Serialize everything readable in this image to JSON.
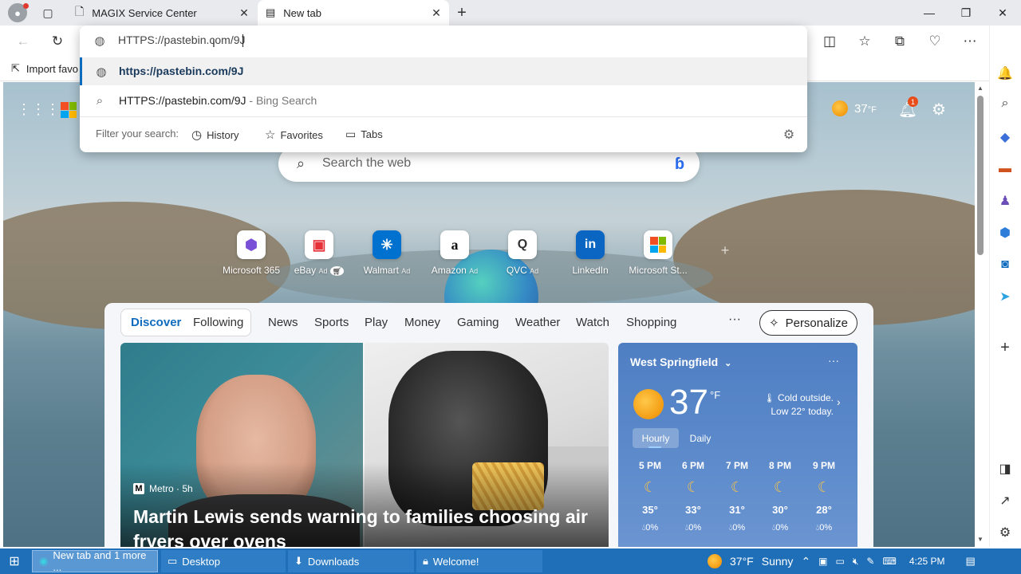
{
  "browser": {
    "tabs": [
      {
        "title": "MAGIX Service Center"
      },
      {
        "title": "New tab"
      }
    ],
    "favorites_bar": {
      "import_label": "Import favo"
    }
  },
  "omnibox": {
    "input_value": "HTTPS://pastebin.com/9J",
    "suggestion_url": "https://pastebin.com/9J",
    "suggestion_search": "HTTPS://pastebin.com/9J",
    "suggestion_search_suffix": " - Bing Search",
    "filter_label": "Filter your search:",
    "filters": [
      "History",
      "Favorites",
      "Tabs"
    ]
  },
  "ntp": {
    "weather_temp": "37",
    "weather_unit": "°F",
    "notification_count": "1",
    "search_placeholder": "Search the web",
    "quick_links": [
      {
        "label": "Microsoft 365",
        "ad": ""
      },
      {
        "label": "eBay",
        "ad": "Ad"
      },
      {
        "label": "Walmart",
        "ad": "Ad"
      },
      {
        "label": "Amazon",
        "ad": "Ad"
      },
      {
        "label": "QVC",
        "ad": "Ad"
      },
      {
        "label": "LinkedIn",
        "ad": ""
      },
      {
        "label": "Microsoft St...",
        "ad": ""
      }
    ],
    "feed_tabs": [
      "Discover",
      "Following",
      "News",
      "Sports",
      "Play",
      "Money",
      "Gaming",
      "Weather",
      "Watch",
      "Shopping"
    ],
    "personalize_label": "Personalize",
    "article": {
      "source": "Metro · 5h",
      "title": "Martin Lewis sends warning to families choosing air fryers over ovens"
    },
    "weather_card": {
      "location": "West Springfield",
      "temp": "37",
      "unit": "°F",
      "caption": "Cold outside. Low 22° today.",
      "tab_hourly": "Hourly",
      "tab_daily": "Daily",
      "hours": [
        {
          "time": "5 PM",
          "temp": "35°",
          "precip": "0%"
        },
        {
          "time": "6 PM",
          "temp": "33°",
          "precip": "0%"
        },
        {
          "time": "7 PM",
          "temp": "31°",
          "precip": "0%"
        },
        {
          "time": "8 PM",
          "temp": "30°",
          "precip": "0%"
        },
        {
          "time": "9 PM",
          "temp": "28°",
          "precip": "0%"
        }
      ]
    }
  },
  "taskbar": {
    "items": [
      "New tab and 1 more ...",
      "Desktop",
      "Downloads",
      "Welcome!"
    ],
    "weather_temp": "37°F",
    "weather_desc": "Sunny",
    "clock": "4:25 PM"
  }
}
